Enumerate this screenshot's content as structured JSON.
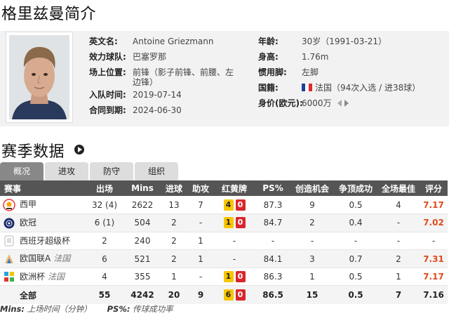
{
  "title": "格里兹曼简介",
  "profile": {
    "english_name_label": "英文名:",
    "english_name": "Antoine Griezmann",
    "club_label": "效力球队:",
    "club": "巴塞罗那",
    "position_label": "场上位置:",
    "position_line1": "前锋（影子前锋、前腰、左",
    "position_line2": "边锋）",
    "joined_label": "入队时间:",
    "joined": "2019-07-14",
    "contract_label": "合同到期:",
    "contract": "2024-06-30",
    "age_label": "年龄:",
    "age": "30岁（1991-03-21）",
    "height_label": "身高:",
    "height": "1.76m",
    "foot_label": "惯用脚:",
    "foot": "左脚",
    "nationality_label": "国籍:",
    "nationality": "法国（94次入选 / 进38球）",
    "value_label": "身价(欧元):",
    "value": "6000万",
    "flag_colors": [
      "#1d3f94",
      "#ffffff",
      "#e02a2a"
    ]
  },
  "section_title": "赛季数据",
  "tabs": [
    {
      "label": "概况",
      "active": true
    },
    {
      "label": "进攻",
      "active": false
    },
    {
      "label": "防守",
      "active": false
    },
    {
      "label": "组织",
      "active": false
    }
  ],
  "table": {
    "headers": [
      "赛事",
      "出场",
      "Mins",
      "进球",
      "助攻",
      "红黄牌",
      "PS%",
      "创造机会",
      "争顶成功",
      "全场最佳",
      "评分"
    ],
    "rows": [
      {
        "comp": "西甲",
        "team": "",
        "icon": "laliga-icon",
        "apps": "32 (4)",
        "mins": "2622",
        "goals": "13",
        "assists": "7",
        "yellow": "4",
        "red": "0",
        "ps": "87.3",
        "chances": "9",
        "aerial": "0.5",
        "motm": "4",
        "rating": "7.17"
      },
      {
        "comp": "欧冠",
        "team": "",
        "icon": "ucl-icon",
        "apps": "6 (1)",
        "mins": "504",
        "goals": "2",
        "assists": "-",
        "yellow": "1",
        "red": "0",
        "ps": "84.7",
        "chances": "2",
        "aerial": "0.4",
        "motm": "-",
        "rating": "7.02"
      },
      {
        "comp": "西班牙超级杯",
        "team": "",
        "icon": "supercopa-icon",
        "apps": "2",
        "mins": "240",
        "goals": "2",
        "assists": "1",
        "yellow": "",
        "red": "",
        "ps": "-",
        "chances": "-",
        "aerial": "-",
        "motm": "-",
        "rating": "-"
      },
      {
        "comp": "欧国联A",
        "team": "法国",
        "icon": "nations-league-icon",
        "apps": "6",
        "mins": "521",
        "goals": "2",
        "assists": "1",
        "yellow": "",
        "red": "",
        "ps": "84.1",
        "chances": "3",
        "aerial": "0.7",
        "motm": "2",
        "rating": "7.31"
      },
      {
        "comp": "欧洲杯",
        "team": "法国",
        "icon": "euro-icon",
        "apps": "4",
        "mins": "355",
        "goals": "1",
        "assists": "-",
        "yellow": "1",
        "red": "0",
        "ps": "86.3",
        "chances": "1",
        "aerial": "0.5",
        "motm": "1",
        "rating": "7.17"
      },
      {
        "comp": "全部",
        "team": "",
        "icon": "",
        "apps": "55",
        "mins": "4242",
        "goals": "20",
        "assists": "9",
        "yellow": "6",
        "red": "0",
        "ps": "86.5",
        "chances": "15",
        "aerial": "0.5",
        "motm": "7",
        "rating": "7.16"
      }
    ]
  },
  "footnote_mins_label": "Mins:",
  "footnote_mins": "上场时间（分钟）",
  "footnote_ps_label": "PS%:",
  "footnote_ps": "传球成功率"
}
